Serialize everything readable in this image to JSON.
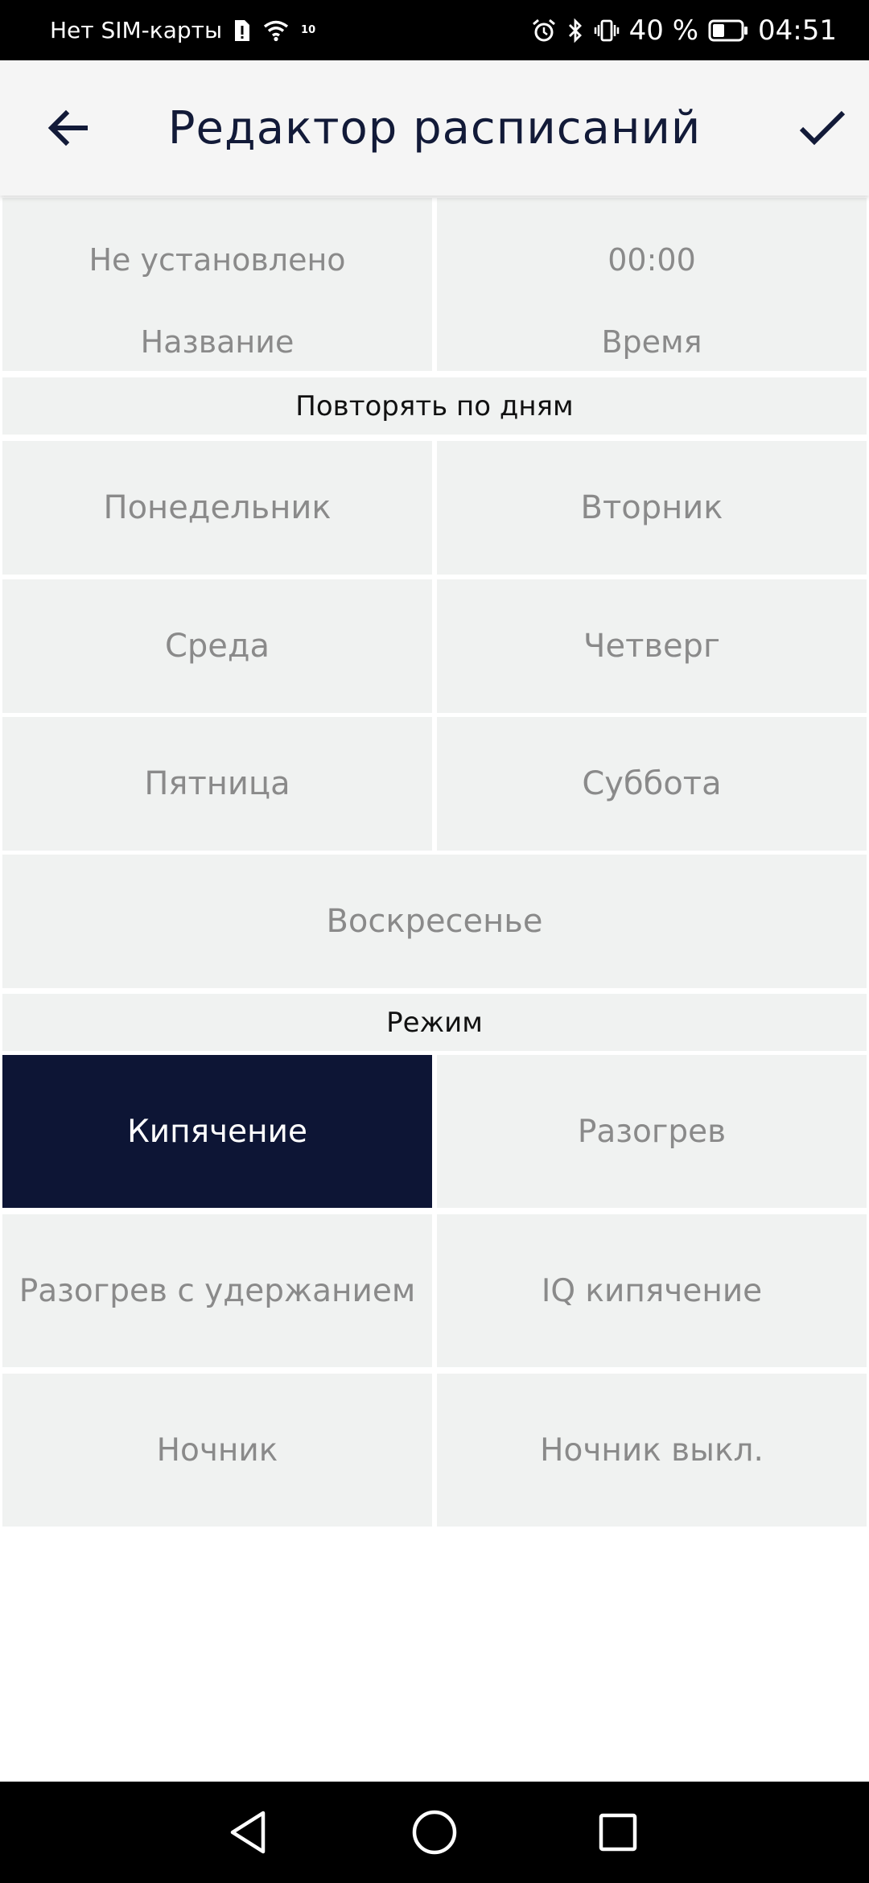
{
  "status_bar": {
    "carrier": "Нет SIM-карты",
    "battery_percent": "40 %",
    "time": "04:51",
    "icons": [
      "sim-alert-icon",
      "wifi-icon",
      "alarm-icon",
      "bluetooth-icon",
      "vibrate-icon",
      "battery-icon"
    ],
    "wifi_tag": "10"
  },
  "app_bar": {
    "title": "Редактор расписаний",
    "back_icon": "arrow-left-icon",
    "confirm_icon": "checkmark-icon"
  },
  "fields": {
    "name": {
      "value": "Не установлено",
      "caption": "Название"
    },
    "time": {
      "value": "00:00",
      "caption": "Время"
    }
  },
  "days_section": {
    "label": "Повторять по дням",
    "days": [
      "Понедельник",
      "Вторник",
      "Среда",
      "Четверг",
      "Пятница",
      "Суббота",
      "Воскресенье"
    ]
  },
  "mode_section": {
    "label": "Режим",
    "modes": [
      "Кипячение",
      "Разогрев",
      "Разогрев с удержанием",
      "IQ кипячение",
      "Ночник",
      "Ночник выкл."
    ],
    "selected": "Кипячение"
  },
  "nav_bar": {
    "icons": [
      "back-triangle-icon",
      "home-circle-icon",
      "recents-square-icon"
    ]
  },
  "colors": {
    "accent": "#0d1535",
    "cell_background": "#f0f2f1",
    "cell_text": "#8a8a8a",
    "title_text": "#121a38"
  }
}
